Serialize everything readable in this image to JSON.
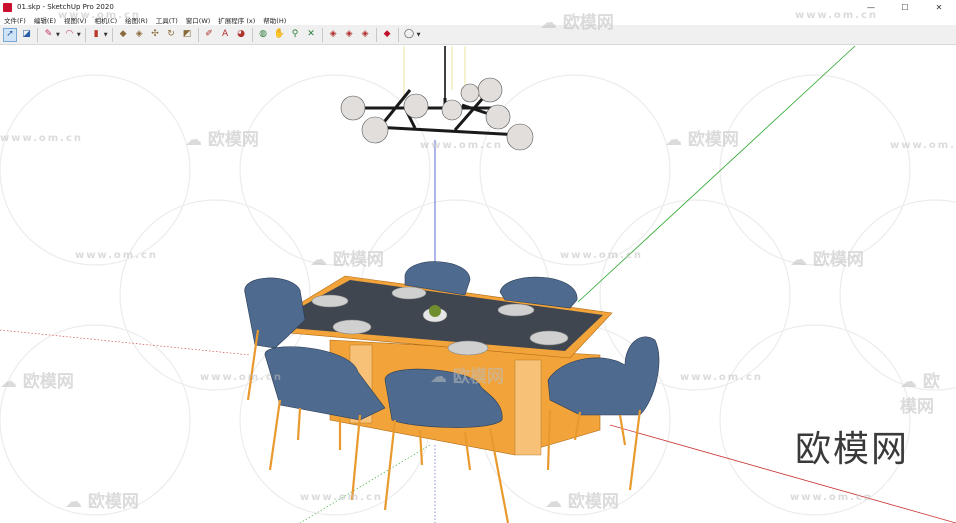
{
  "window": {
    "title": "01.skp - SketchUp Pro 2020",
    "minimize": "—",
    "maximize": "☐",
    "close": "✕"
  },
  "menu": [
    "文件(F)",
    "编辑(E)",
    "视图(V)",
    "相机(C)",
    "绘图(R)",
    "工具(T)",
    "窗口(W)",
    "扩展程序 (x)",
    "帮助(H)"
  ],
  "toolbar": {
    "groups": [
      [
        {
          "icon": "select-arrow-icon",
          "glyph": "➚",
          "selected": true
        },
        {
          "icon": "eraser-icon",
          "glyph": "◪"
        }
      ],
      [
        {
          "icon": "pencil-line-icon",
          "glyph": "✎",
          "dropdown": true
        },
        {
          "icon": "arc-icon",
          "glyph": "◠",
          "dropdown": true
        }
      ],
      [
        {
          "icon": "shape-rectangle-icon",
          "glyph": "▮",
          "dropdown": true
        }
      ],
      [
        {
          "icon": "push-pull-icon",
          "glyph": "◆"
        },
        {
          "icon": "offset-icon",
          "glyph": "◈"
        },
        {
          "icon": "move-icon",
          "glyph": "✣"
        },
        {
          "icon": "rotate-icon",
          "glyph": "↻"
        },
        {
          "icon": "scale-icon",
          "glyph": "◩"
        }
      ],
      [
        {
          "icon": "tape-measure-icon",
          "glyph": "✐"
        },
        {
          "icon": "text-label-icon",
          "glyph": "A"
        },
        {
          "icon": "paint-bucket-icon",
          "glyph": "◕"
        }
      ],
      [
        {
          "icon": "orbit-icon",
          "glyph": "◍"
        },
        {
          "icon": "pan-icon",
          "glyph": "✋"
        },
        {
          "icon": "zoom-icon",
          "glyph": "⚲"
        },
        {
          "icon": "zoom-extents-icon",
          "glyph": "✕"
        }
      ],
      [
        {
          "icon": "3d-warehouse-icon",
          "glyph": "◈"
        },
        {
          "icon": "extension-warehouse-icon",
          "glyph": "◈"
        },
        {
          "icon": "layout-icon",
          "glyph": "◈"
        }
      ],
      [
        {
          "icon": "ruby-icon",
          "glyph": "◆"
        }
      ],
      [
        {
          "icon": "user-account-icon",
          "glyph": "◯",
          "dropdown": true
        }
      ]
    ]
  },
  "watermark": {
    "url_text": "www.om.cn",
    "brand_text": "欧模网",
    "big_text": "欧模网"
  },
  "colors": {
    "toolbar_bg": "#f0f0f0",
    "table_frame": "#f2a33a",
    "table_top": "#3f4650",
    "chair": "#4e6a8f",
    "axis_green": "#2aa52a",
    "axis_red": "#cc3333",
    "axis_blue": "#3344cc"
  }
}
